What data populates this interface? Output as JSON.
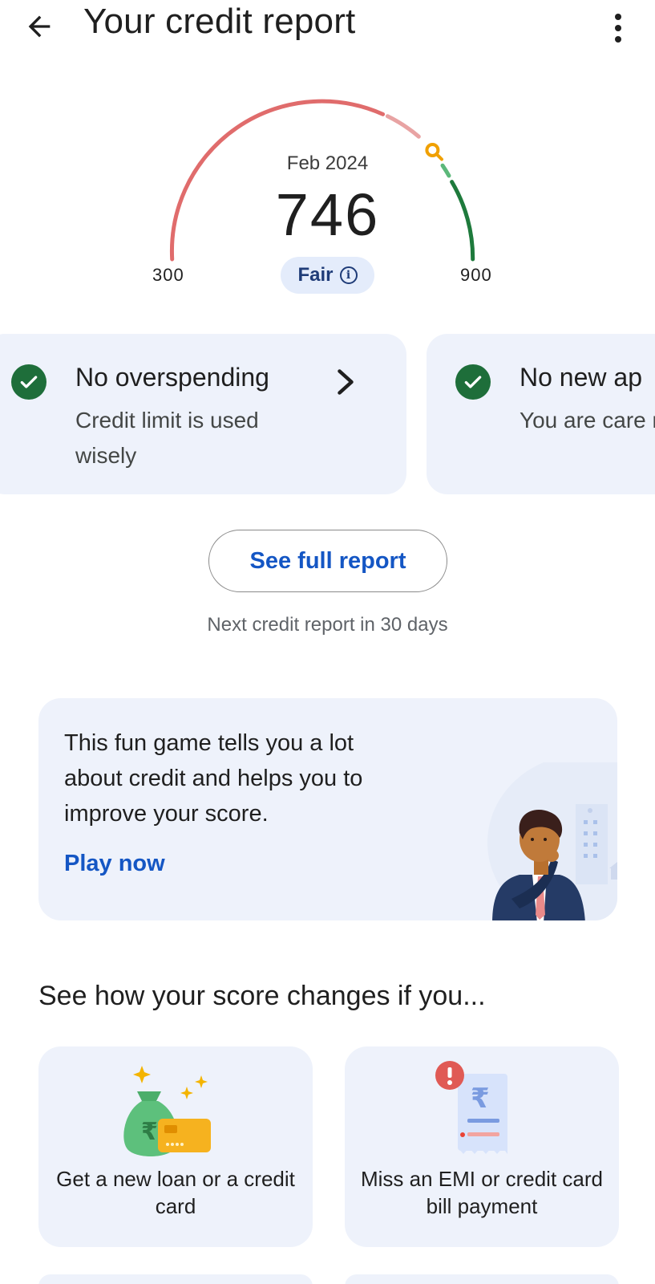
{
  "header": {
    "title": "Your credit report",
    "back_icon": "arrow-back-icon",
    "menu_icon": "more-vert-icon"
  },
  "score": {
    "date": "Feb 2024",
    "value": "746",
    "min_label": "300",
    "max_label": "900",
    "min": 300,
    "max": 900,
    "score_num": 746,
    "rating": "Fair",
    "colors": {
      "poor": "#e06c6c",
      "fair": "#e8a3a3",
      "good": "#5cb87a",
      "excellent": "#1e7a3c",
      "marker": "#f0a000"
    }
  },
  "factors": [
    {
      "title": "No overspending",
      "desc": "Credit limit is used wisely"
    },
    {
      "title": "No new ap",
      "desc": "You are care new credit..."
    }
  ],
  "report": {
    "button": "See full report",
    "next": "Next credit report in 30 days"
  },
  "game": {
    "text": "This fun game tells you a lot about credit and helps you to improve your score.",
    "link": "Play now"
  },
  "simulations": {
    "title": "See how your score changes if you...",
    "items": [
      {
        "label": "Get a new loan or a credit card",
        "icon": "money-bag-card-icon"
      },
      {
        "label": "Miss an EMI or credit card bill payment",
        "icon": "missed-bill-alert-icon"
      }
    ]
  }
}
